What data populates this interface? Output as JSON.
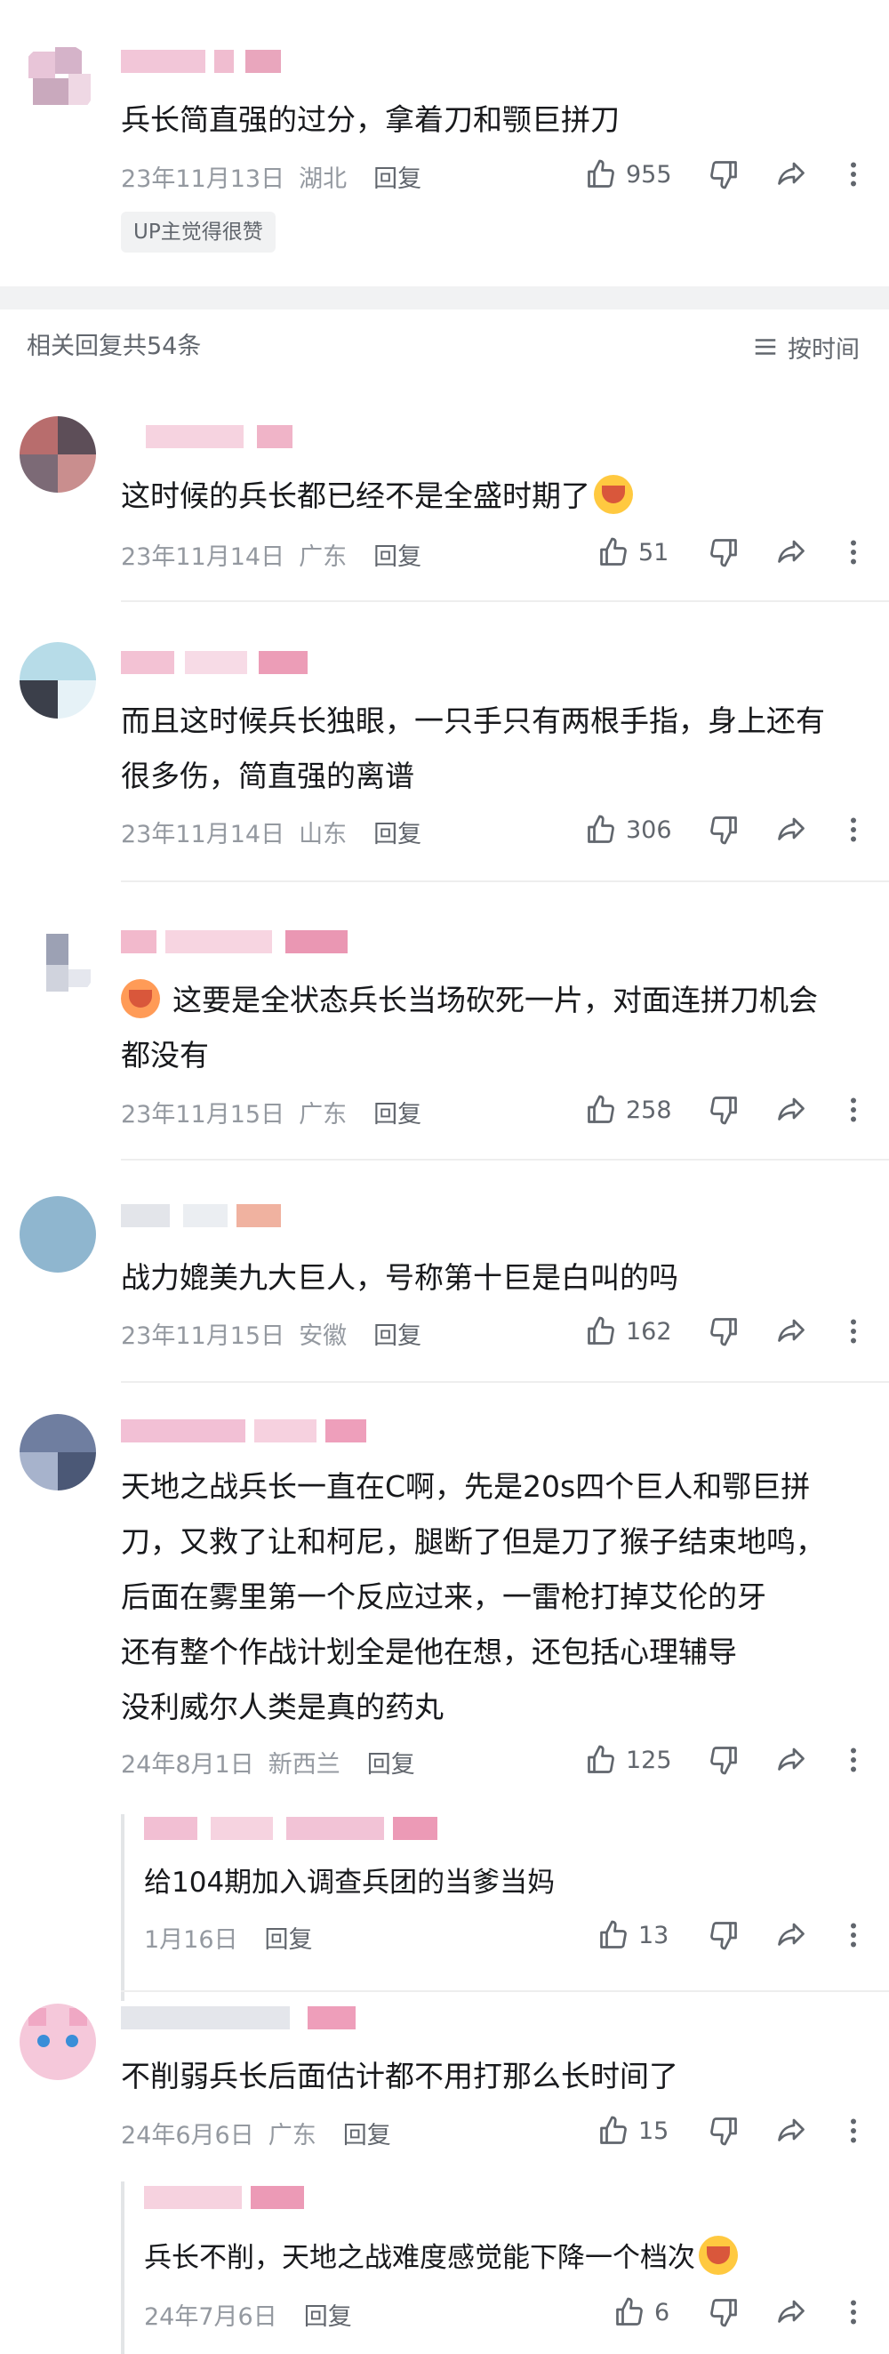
{
  "top_comment": {
    "text": "兵长简直强的过分，拿着刀和颚巨拼刀",
    "date": "23年11月13日",
    "location": "湖北",
    "reply_label": "回复",
    "likes": "955",
    "badge": "UP主觉得很赞"
  },
  "replies_header": {
    "count_label": "相关回复共54条",
    "sort_label": "按时间"
  },
  "comments": [
    {
      "text": "这时候的兵长都已经不是全盛时期了",
      "date": "23年11月14日",
      "location": "广东",
      "reply_label": "回复",
      "likes": "51",
      "emoji": "crying-laugh-emoji"
    },
    {
      "text_lines": [
        "而且这时候兵长独眼，一只手只有两根手指，身上还有",
        "很多伤，简直强的离谱"
      ],
      "date": "23年11月14日",
      "location": "山东",
      "reply_label": "回复",
      "likes": "306"
    },
    {
      "text_lines": [
        "这要是全状态兵长当场砍死一片，对面连拼刀机会",
        "都没有"
      ],
      "date": "23年11月15日",
      "location": "广东",
      "reply_label": "回复",
      "likes": "258",
      "emoji": "hot-face-emoji"
    },
    {
      "text": "战力媲美九大巨人，号称第十巨是白叫的吗",
      "date": "23年11月15日",
      "location": "安徽",
      "reply_label": "回复",
      "likes": "162"
    },
    {
      "text_lines": [
        "天地之战兵长一直在C啊，先是20s四个巨人和鄂巨拼",
        "刀，又救了让和柯尼，腿断了但是刀了猴子结束地鸣，",
        "后面在雾里第一个反应过来，一雷枪打掉艾伦的牙",
        "还有整个作战计划全是他在想，还包括心理辅导",
        "没利威尔人类是真的药丸"
      ],
      "date": "24年8月1日",
      "location": "新西兰",
      "reply_label": "回复",
      "likes": "125",
      "sub": {
        "text": "给104期加入调查兵团的当爹当妈",
        "date": "1月16日",
        "reply_label": "回复",
        "likes": "13"
      }
    },
    {
      "text": "不削弱兵长后面估计都不用打那么长时间了",
      "date": "24年6月6日",
      "location": "广东",
      "reply_label": "回复",
      "likes": "15",
      "sub": {
        "text": "兵长不削，天地之战难度感觉能下降一个档次",
        "date": "24年7月6日",
        "reply_label": "回复",
        "likes": "6",
        "emoji": "crying-laugh-emoji"
      }
    }
  ]
}
